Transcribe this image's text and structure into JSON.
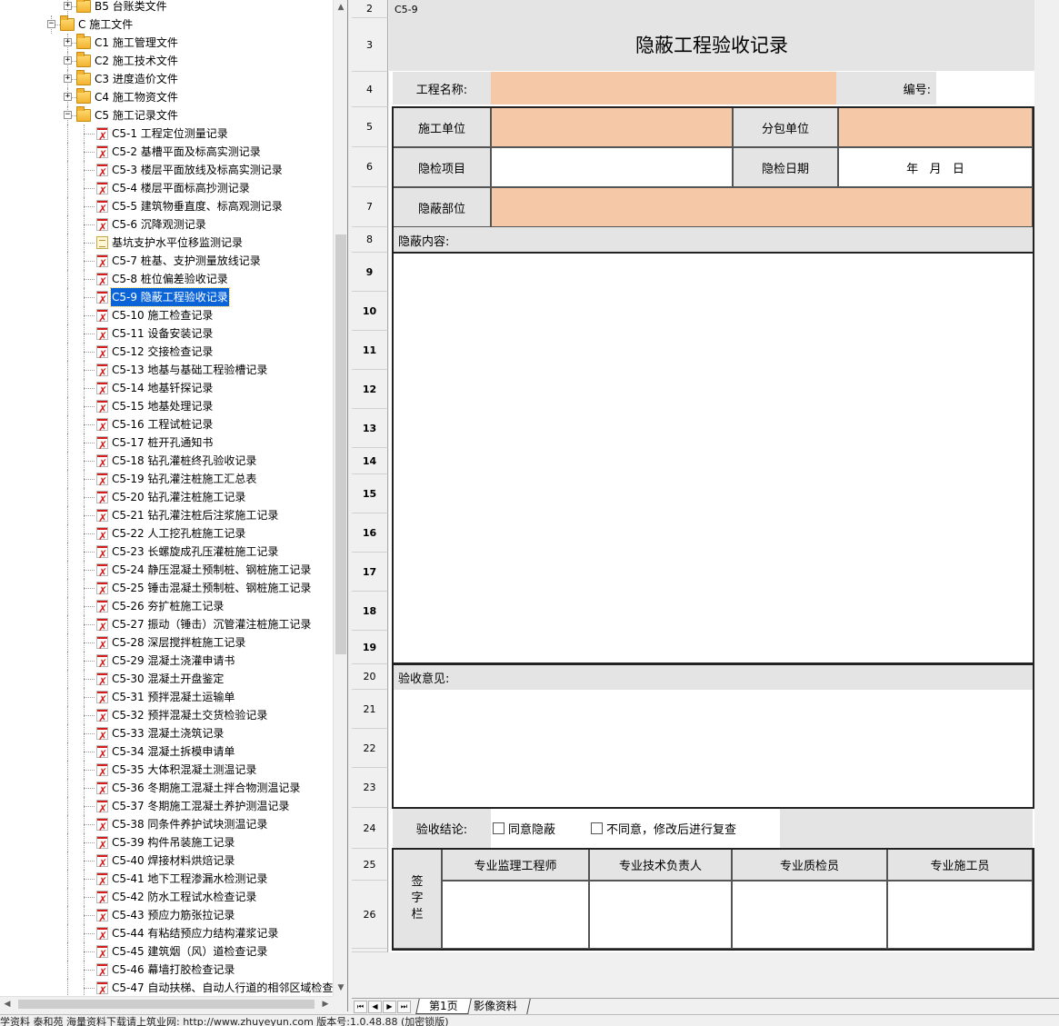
{
  "tree": {
    "items": [
      {
        "label": "B5 台账类文件",
        "type": "folder",
        "level": 2
      },
      {
        "label": "C 施工文件",
        "type": "folder-open",
        "level": 1
      },
      {
        "label": "C1 施工管理文件",
        "type": "folder",
        "level": 2
      },
      {
        "label": "C2 施工技术文件",
        "type": "folder",
        "level": 2
      },
      {
        "label": "C3 进度造价文件",
        "type": "folder",
        "level": 2
      },
      {
        "label": "C4 施工物资文件",
        "type": "folder",
        "level": 2
      },
      {
        "label": "C5 施工记录文件",
        "type": "folder-open",
        "level": 2
      },
      {
        "label": "C5-1 工程定位测量记录",
        "type": "pdf",
        "level": 3
      },
      {
        "label": "C5-2 基槽平面及标高实测记录",
        "type": "pdf",
        "level": 3
      },
      {
        "label": "C5-3 楼层平面放线及标高实测记录",
        "type": "pdf",
        "level": 3
      },
      {
        "label": "C5-4 楼层平面标高抄测记录",
        "type": "pdf",
        "level": 3
      },
      {
        "label": "C5-5 建筑物垂直度、标高观测记录",
        "type": "pdf",
        "level": 3
      },
      {
        "label": "C5-6 沉降观测记录",
        "type": "pdf",
        "level": 3
      },
      {
        "label": "基坑支护水平位移监测记录",
        "type": "note",
        "level": 3
      },
      {
        "label": "C5-7 桩基、支护测量放线记录",
        "type": "pdf",
        "level": 3
      },
      {
        "label": "C5-8 桩位偏差验收记录",
        "type": "pdf",
        "level": 3
      },
      {
        "label": "C5-9 隐蔽工程验收记录",
        "type": "pdf",
        "level": 3,
        "selected": true
      },
      {
        "label": "C5-10 施工检查记录",
        "type": "pdf",
        "level": 3
      },
      {
        "label": "C5-11 设备安装记录",
        "type": "pdf",
        "level": 3
      },
      {
        "label": "C5-12 交接检查记录",
        "type": "pdf",
        "level": 3
      },
      {
        "label": "C5-13 地基与基础工程验槽记录",
        "type": "pdf",
        "level": 3
      },
      {
        "label": "C5-14 地基钎探记录",
        "type": "pdf",
        "level": 3
      },
      {
        "label": "C5-15 地基处理记录",
        "type": "pdf",
        "level": 3
      },
      {
        "label": "C5-16 工程试桩记录",
        "type": "pdf",
        "level": 3
      },
      {
        "label": "C5-17 桩开孔通知书",
        "type": "pdf",
        "level": 3
      },
      {
        "label": "C5-18 钻孔灌桩终孔验收记录",
        "type": "pdf",
        "level": 3
      },
      {
        "label": "C5-19 钻孔灌注桩施工汇总表",
        "type": "pdf",
        "level": 3
      },
      {
        "label": "C5-20 钻孔灌注桩施工记录",
        "type": "pdf",
        "level": 3
      },
      {
        "label": "C5-21 钻孔灌注桩后注浆施工记录",
        "type": "pdf",
        "level": 3
      },
      {
        "label": "C5-22 人工挖孔桩施工记录",
        "type": "pdf",
        "level": 3
      },
      {
        "label": "C5-23 长螺旋成孔压灌桩施工记录",
        "type": "pdf",
        "level": 3
      },
      {
        "label": "C5-24 静压混凝土预制桩、钢桩施工记录",
        "type": "pdf",
        "level": 3
      },
      {
        "label": "C5-25 锤击混凝土预制桩、钢桩施工记录",
        "type": "pdf",
        "level": 3
      },
      {
        "label": "C5-26 夯扩桩施工记录",
        "type": "pdf",
        "level": 3
      },
      {
        "label": "C5-27 振动（锤击）沉管灌注桩施工记录",
        "type": "pdf",
        "level": 3
      },
      {
        "label": "C5-28 深层搅拌桩施工记录",
        "type": "pdf",
        "level": 3
      },
      {
        "label": "C5-29 混凝土浇灌申请书",
        "type": "pdf",
        "level": 3
      },
      {
        "label": "C5-30 混凝土开盘鉴定",
        "type": "pdf",
        "level": 3
      },
      {
        "label": "C5-31 预拌混凝土运输单",
        "type": "pdf",
        "level": 3
      },
      {
        "label": "C5-32 预拌混凝土交货检验记录",
        "type": "pdf",
        "level": 3
      },
      {
        "label": "C5-33 混凝土浇筑记录",
        "type": "pdf",
        "level": 3
      },
      {
        "label": "C5-34 混凝土拆模申请单",
        "type": "pdf",
        "level": 3
      },
      {
        "label": "C5-35 大体积混凝土测温记录",
        "type": "pdf",
        "level": 3
      },
      {
        "label": "C5-36 冬期施工混凝土拌合物测温记录",
        "type": "pdf",
        "level": 3
      },
      {
        "label": "C5-37 冬期施工混凝土养护测温记录",
        "type": "pdf",
        "level": 3
      },
      {
        "label": "C5-38 同条件养护试块测温记录",
        "type": "pdf",
        "level": 3
      },
      {
        "label": "C5-39 构件吊装施工记录",
        "type": "pdf",
        "level": 3
      },
      {
        "label": "C5-40 焊接材料烘焙记录",
        "type": "pdf",
        "level": 3
      },
      {
        "label": "C5-41 地下工程渗漏水检测记录",
        "type": "pdf",
        "level": 3
      },
      {
        "label": "C5-42 防水工程试水检查记录",
        "type": "pdf",
        "level": 3
      },
      {
        "label": "C5-43 预应力筋张拉记录",
        "type": "pdf",
        "level": 3
      },
      {
        "label": "C5-44 有粘结预应力结构灌浆记录",
        "type": "pdf",
        "level": 3
      },
      {
        "label": "C5-45 建筑烟（风）道检查记录",
        "type": "pdf",
        "level": 3
      },
      {
        "label": "C5-46 幕墙打胶检查记录",
        "type": "pdf",
        "level": 3
      },
      {
        "label": "C5-47 自动扶梯、自动人行道的相邻区域检查",
        "type": "pdf",
        "level": 3
      }
    ]
  },
  "sheet": {
    "row_numbers": [
      "2",
      "3",
      "4",
      "5",
      "6",
      "7",
      "8",
      "9",
      "10",
      "11",
      "12",
      "13",
      "14",
      "15",
      "16",
      "17",
      "18",
      "19",
      "20",
      "21",
      "22",
      "23",
      "24",
      "25",
      "26"
    ],
    "code": "C5-9",
    "title": "隐蔽工程验收记录",
    "project_name_label": "工程名称:",
    "number_label": "编号:",
    "construction_unit_label": "施工单位",
    "subcontract_unit_label": "分包单位",
    "inspection_item_label": "隐检项目",
    "inspection_date_label": "隐检日期",
    "inspection_date_value": "年   月   日",
    "concealed_part_label": "隐蔽部位",
    "concealed_content_label": "隐蔽内容:",
    "acceptance_opinion_label": "验收意见:",
    "conclusion_label": "验收结论:",
    "option_agree": "同意隐蔽",
    "option_disagree": "不同意，修改后进行复查",
    "signature_label": "签\n字\n栏",
    "signers": [
      "专业监理工程师",
      "专业技术负责人",
      "专业质检员",
      "专业施工员"
    ]
  },
  "tabs": {
    "sheets": [
      "第1页",
      "影像资料"
    ],
    "nav": [
      "⏮",
      "◀",
      "▶",
      "⏭"
    ]
  },
  "status_bar": {
    "text": "学资料   泰和苑   海量资料下载请上筑业网: http://www.zhuyeyun.com    版本号:1.0.48.88 (加密锁版)"
  },
  "colors": {
    "highlight": "#0a64d8",
    "peach_cell": "#f5c9a7",
    "gray_cell": "#e4e4e4"
  }
}
